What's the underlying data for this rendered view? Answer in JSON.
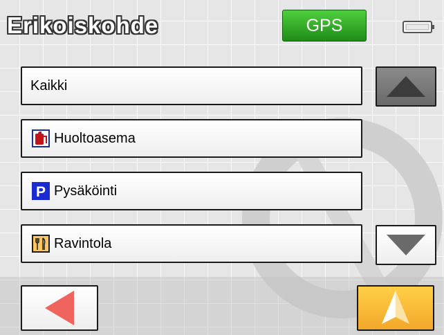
{
  "header": {
    "title": "Erikoiskohde",
    "gps_label": "GPS",
    "gps_color": "#2fa824"
  },
  "categories": [
    {
      "label": "Kaikki",
      "icon": null
    },
    {
      "label": "Huoltoasema",
      "icon": "fuel-station-icon"
    },
    {
      "label": "Pysäköinti",
      "icon": "parking-icon"
    },
    {
      "label": "Ravintola",
      "icon": "restaurant-icon"
    }
  ],
  "parking_letter": "P",
  "controls": {
    "scroll_up_icon": "arrow-up-icon",
    "scroll_down_icon": "arrow-down-icon",
    "back_icon": "back-arrow-icon",
    "navigate_icon": "navigation-arrow-icon",
    "navigate_color": "#f5b732",
    "back_arrow_color": "#f0645e"
  }
}
